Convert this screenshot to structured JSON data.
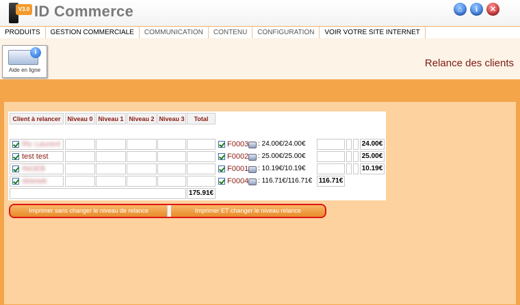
{
  "header": {
    "logo_version": "V3.0",
    "app_title": "ID Commerce",
    "icons": [
      "home-icon",
      "info-icon",
      "close-icon"
    ]
  },
  "menu": {
    "items": [
      "PRODUITS",
      "GESTION COMMERCIALE",
      "COMMUNICATION",
      "CONTENU",
      "CONFIGURATION",
      "VOIR VOTRE SITE INTERNET"
    ]
  },
  "toolbar": {
    "help_label": "Aide en ligne",
    "page_title": "Relance des clients"
  },
  "table": {
    "headers": [
      "Client à relancer",
      "Niveau 0",
      "Niveau 1",
      "Niveau 2",
      "Niveau 3",
      "Total"
    ],
    "rows": [
      {
        "client": "Ric Laurent",
        "invoice": "F0003",
        "amount": ": 24.00€/24.00€",
        "total": "24.00€"
      },
      {
        "client": "test test",
        "invoice": "F0002",
        "amount": ": 25.00€/25.00€",
        "total": "25.00€"
      },
      {
        "client": "INGEB",
        "invoice": "F0001",
        "amount": ": 10.19€/10.19€",
        "total": "10.19€"
      },
      {
        "client": "skiesek",
        "invoice": "F0004",
        "amount": ": 116.71€/116.71€",
        "total": "116.71€"
      }
    ],
    "grand_total": "175.91€"
  },
  "actions": {
    "print_no_change": "Imprimer sans changer le niveau de relance",
    "print_change": "Imprimer ET changer le niveau relance"
  },
  "colors": {
    "accent_orange": "#f4a54a",
    "content_bg": "#fdd29f",
    "link_red": "#8b1a12",
    "highlight_red": "#e01414"
  }
}
